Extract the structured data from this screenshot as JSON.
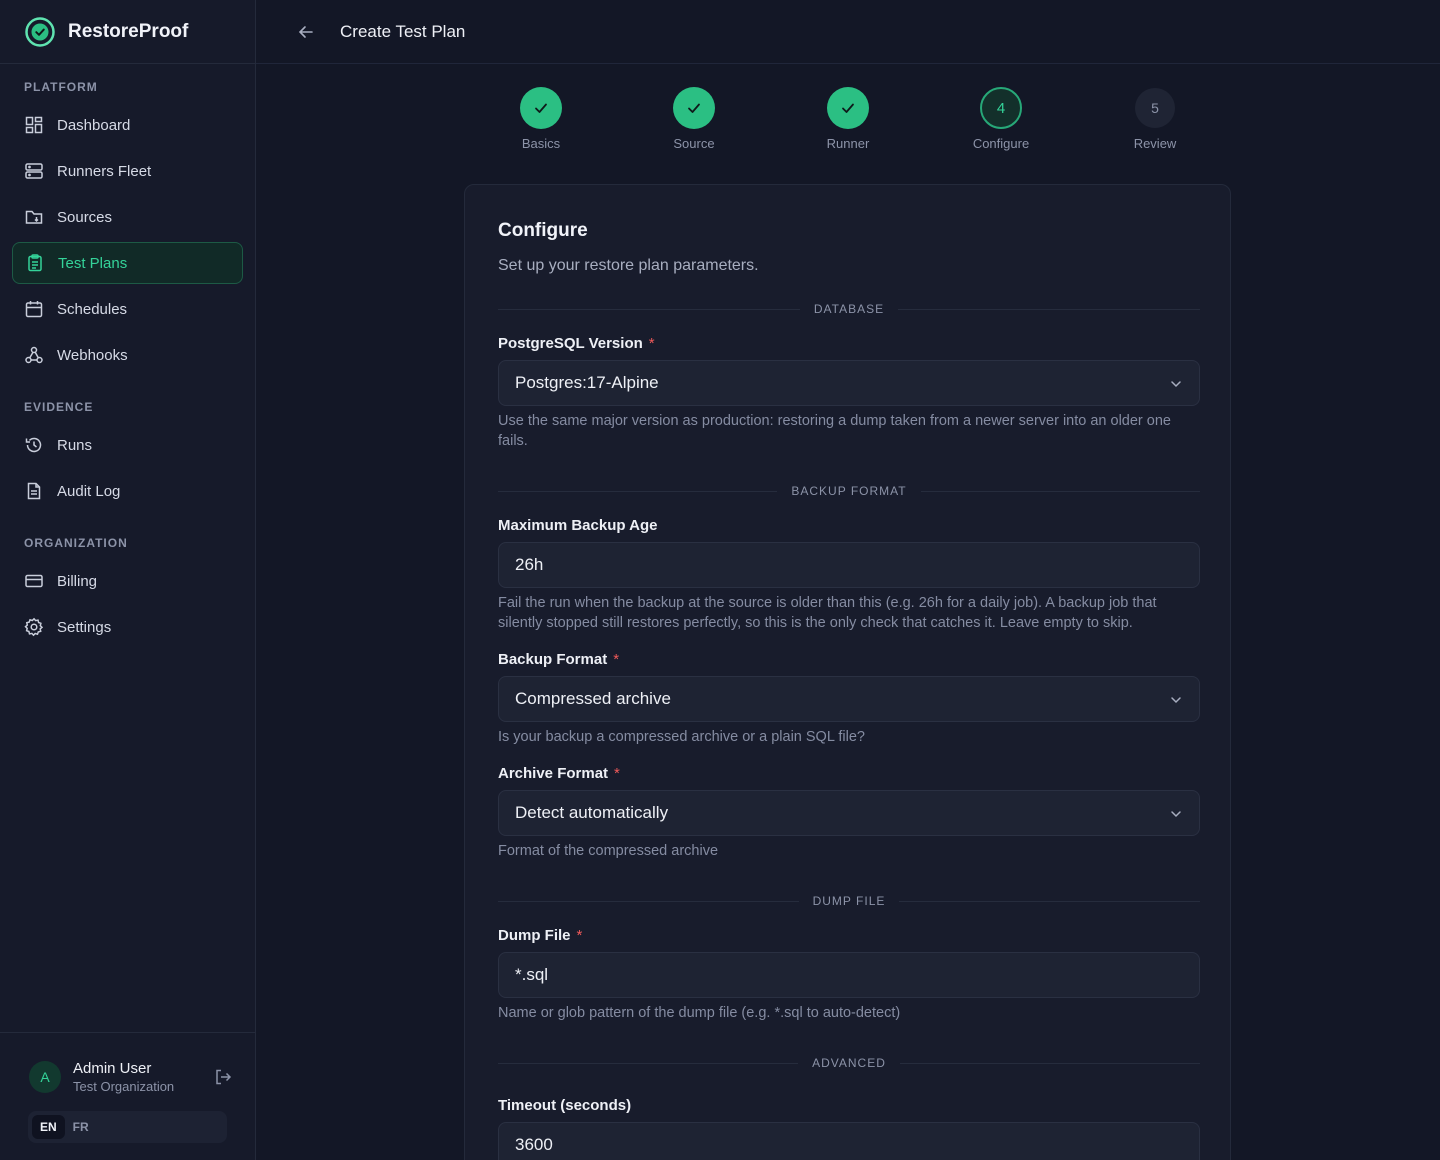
{
  "brand": {
    "name": "RestoreProof"
  },
  "sidebar": {
    "sections": [
      {
        "title": "PLATFORM"
      },
      {
        "title": "EVIDENCE"
      },
      {
        "title": "ORGANIZATION"
      }
    ],
    "items": [
      {
        "label": "Dashboard",
        "icon": "dashboard-icon"
      },
      {
        "label": "Runners Fleet",
        "icon": "server-icon"
      },
      {
        "label": "Sources",
        "icon": "folder-icon"
      },
      {
        "label": "Test Plans",
        "icon": "clipboard-icon"
      },
      {
        "label": "Schedules",
        "icon": "calendar-icon"
      },
      {
        "label": "Webhooks",
        "icon": "webhook-icon"
      },
      {
        "label": "Runs",
        "icon": "history-icon"
      },
      {
        "label": "Audit Log",
        "icon": "document-icon"
      },
      {
        "label": "Billing",
        "icon": "credit-card-icon"
      },
      {
        "label": "Settings",
        "icon": "gear-icon"
      }
    ],
    "active_item": "Test Plans",
    "user": {
      "initial": "A",
      "name": "Admin User",
      "org": "Test Organization"
    },
    "languages": [
      "EN",
      "FR"
    ],
    "active_language": "EN"
  },
  "topbar": {
    "title": "Create Test Plan"
  },
  "stepper": {
    "steps": [
      {
        "number": "1",
        "label": "Basics",
        "state": "done"
      },
      {
        "number": "2",
        "label": "Source",
        "state": "done"
      },
      {
        "number": "3",
        "label": "Runner",
        "state": "done"
      },
      {
        "number": "4",
        "label": "Configure",
        "state": "current"
      },
      {
        "number": "5",
        "label": "Review",
        "state": "todo"
      }
    ]
  },
  "form": {
    "title": "Configure",
    "subtitle": "Set up your restore plan parameters.",
    "sections": {
      "database": "DATABASE",
      "backup_format": "BACKUP FORMAT",
      "dump_file": "DUMP FILE",
      "advanced": "ADVANCED"
    },
    "pg_version": {
      "label": "PostgreSQL Version",
      "value": "Postgres:17-Alpine",
      "help": "Use the same major version as production: restoring a dump taken from a newer server into an older one fails."
    },
    "max_backup_age": {
      "label": "Maximum Backup Age",
      "value": "26h",
      "help": "Fail the run when the backup at the source is older than this (e.g. 26h for a daily job). A backup job that silently stopped still restores perfectly, so this is the only check that catches it. Leave empty to skip."
    },
    "backup_format": {
      "label": "Backup Format",
      "value": "Compressed archive",
      "help": "Is your backup a compressed archive or a plain SQL file?"
    },
    "archive_format": {
      "label": "Archive Format",
      "value": "Detect automatically",
      "help": "Format of the compressed archive"
    },
    "dump_file": {
      "label": "Dump File",
      "value": "*.sql",
      "help": "Name or glob pattern of the dump file (e.g. *.sql to auto-detect)"
    },
    "timeout": {
      "label": "Timeout (seconds)",
      "value": "3600"
    },
    "required_mark": "*"
  },
  "colors": {
    "accent": "#34d399",
    "background": "#131726",
    "required": "#f05a5a"
  }
}
